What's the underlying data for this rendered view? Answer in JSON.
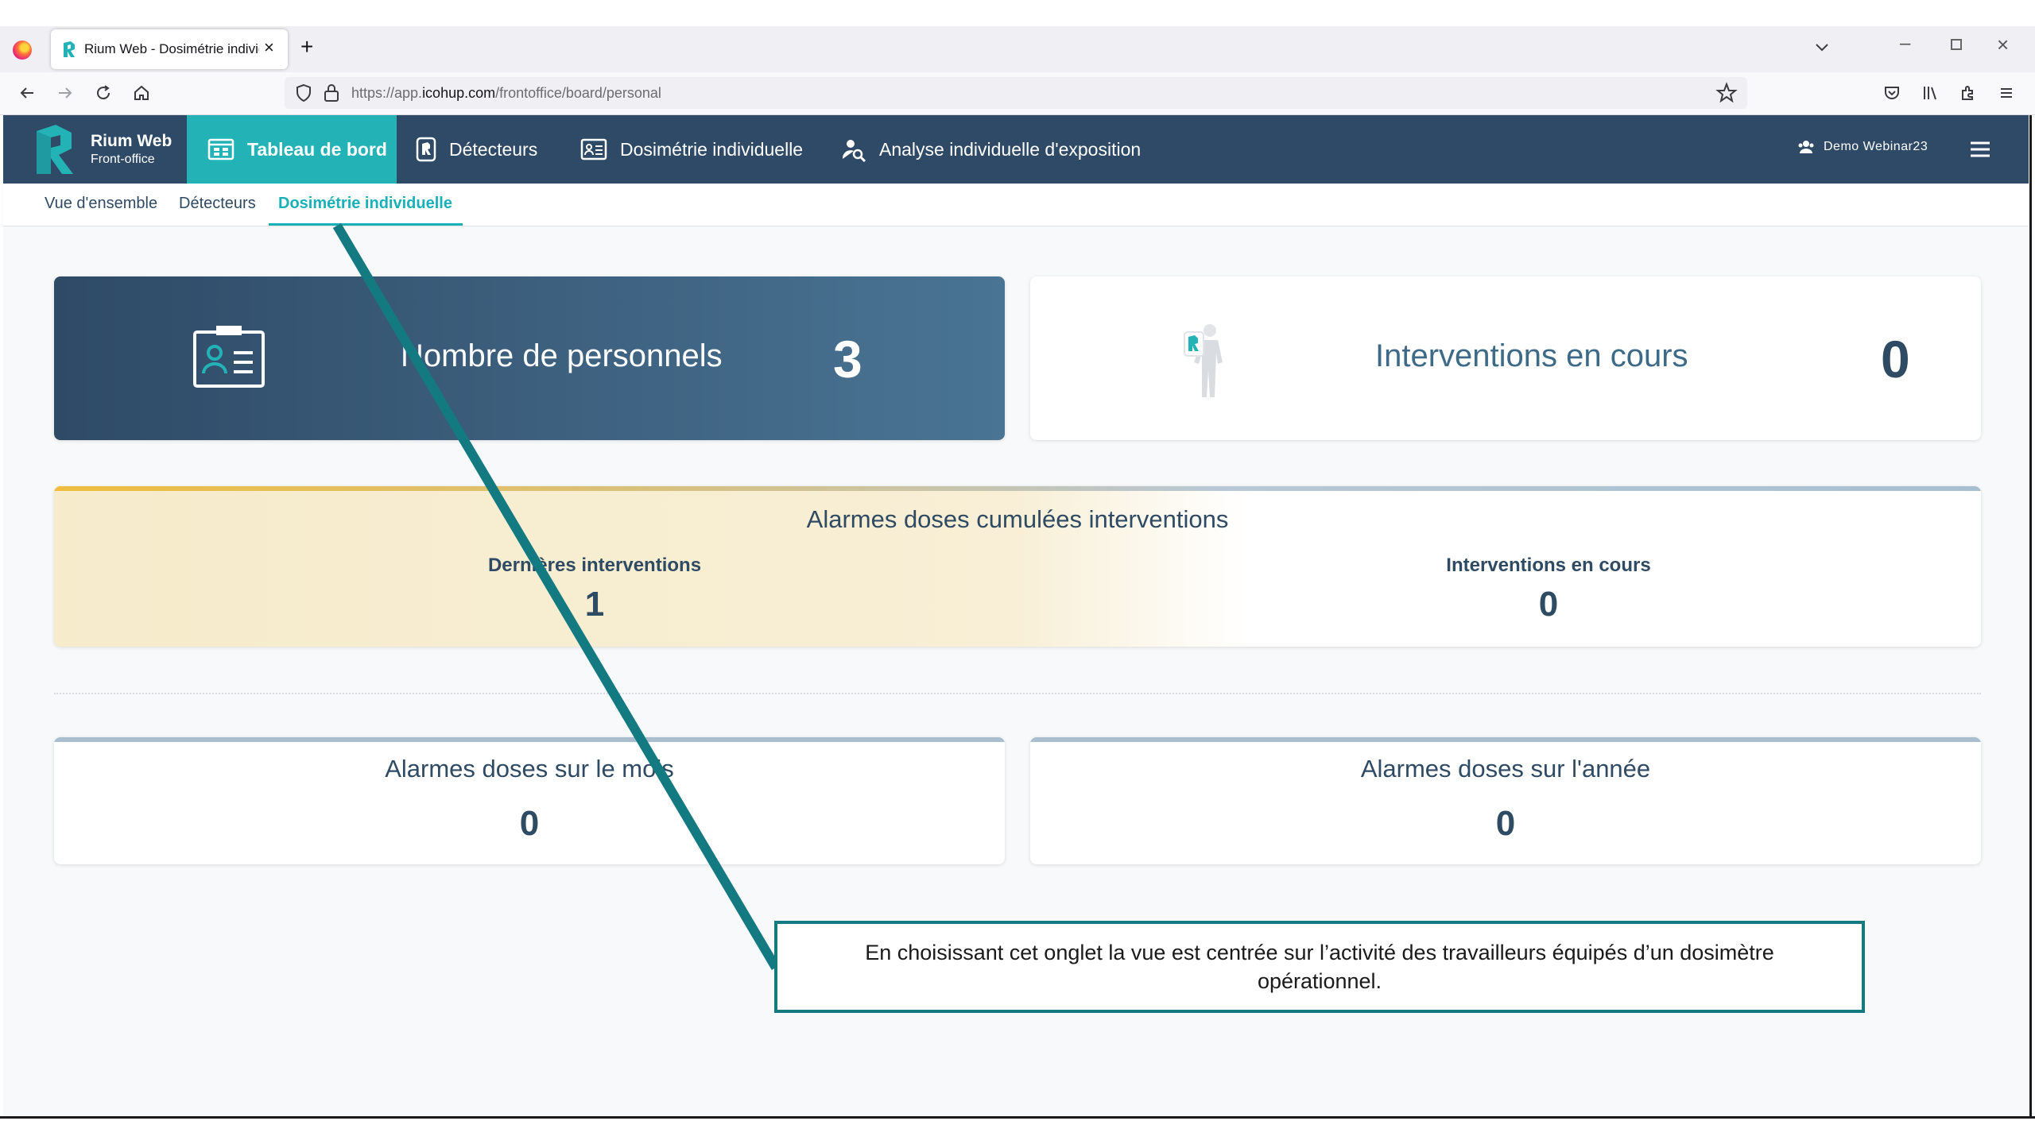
{
  "browser": {
    "tab_title": "Rium Web - Dosimétrie individuelle",
    "tab_close": "×",
    "new_tab": "+",
    "url_prefix": "https://app.",
    "url_domain": "icohup.com",
    "url_path": "/frontoffice/board/personal",
    "window_min": "–",
    "window_close": "×"
  },
  "app": {
    "brand_name": "Rium Web",
    "brand_sub": "Front-office",
    "menu": {
      "dashboard": "Tableau de bord",
      "detectors": "Détecteurs",
      "dosimetry": "Dosimétrie individuelle",
      "analysis": "Analyse individuelle d'exposition"
    },
    "user_name": "Demo Webinar23"
  },
  "subnav": {
    "overview": "Vue d'ensemble",
    "detectors": "Détecteurs",
    "dosimetry": "Dosimétrie individuelle"
  },
  "cards": {
    "personnel": {
      "label": "Nombre de personnels",
      "value": "3"
    },
    "interventions": {
      "label": "Interventions en cours",
      "value": "0"
    },
    "cumulative": {
      "title": "Alarmes doses cumulées interventions",
      "last_label": "Dernières interventions",
      "last_value": "1",
      "current_label": "Interventions en cours",
      "current_value": "0"
    },
    "month": {
      "title": "Alarmes doses sur le mois",
      "value": "0"
    },
    "year": {
      "title": "Alarmes doses sur l'année",
      "value": "0"
    }
  },
  "annotation": {
    "text": "En choisissant cet onglet la vue est centrée sur l’activité des travailleurs équipés d’un dosimètre opérationnel."
  },
  "colors": {
    "header": "#2e4a66",
    "accent": "#23b3b6",
    "annotation": "#147a82"
  }
}
